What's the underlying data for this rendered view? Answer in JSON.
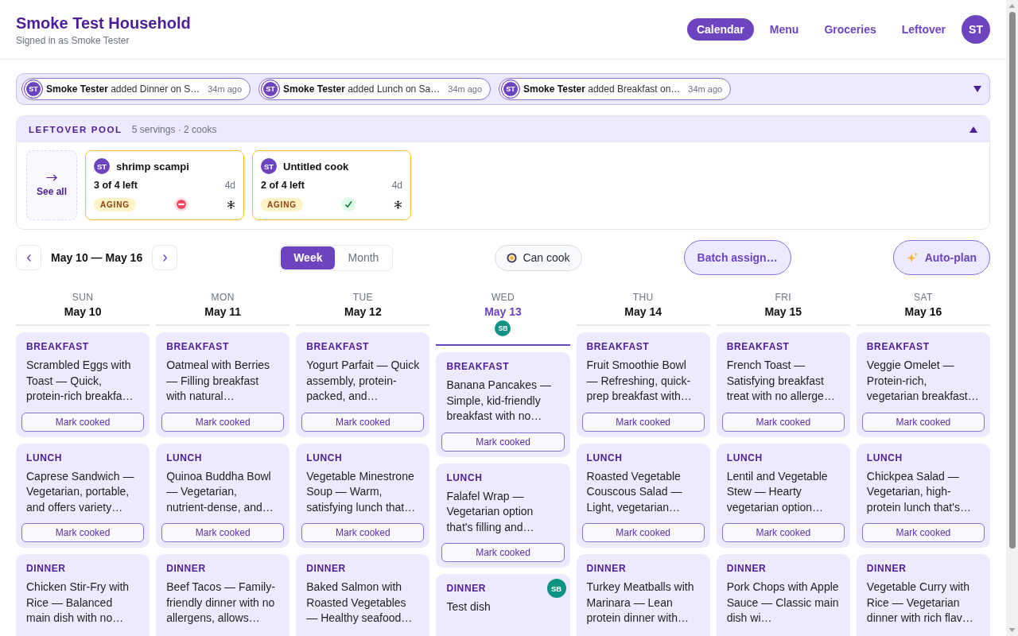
{
  "header": {
    "title": "Smoke Test Household",
    "subtitle": "Signed in as Smoke Tester",
    "nav": [
      {
        "label": "Calendar",
        "selected": true
      },
      {
        "label": "Menu",
        "selected": false
      },
      {
        "label": "Groceries",
        "selected": false
      },
      {
        "label": "Leftover",
        "selected": false
      }
    ],
    "avatar": "ST"
  },
  "activity": {
    "expanded": false,
    "items": [
      {
        "avatar": "ST",
        "text": "**Smoke Tester** added Dinner on S…",
        "time": "34m ago"
      },
      {
        "avatar": "ST",
        "text": "**Smoke Tester** added Lunch on Sa…",
        "time": "34m ago"
      },
      {
        "avatar": "ST",
        "text": "**Smoke Tester** added Breakfast on…",
        "time": "34m ago"
      }
    ]
  },
  "leftover_pool": {
    "title": "LEFTOVER POOL",
    "summary": "5 servings · 2 cooks",
    "expanded": true,
    "see_all": "See all",
    "items": [
      {
        "avatar": "ST",
        "name": "shrimp scampi",
        "remaining": "3 of 4 left",
        "age": "4d",
        "badge": "AGING",
        "blocked": true
      },
      {
        "avatar": "ST",
        "name": "Untitled cook",
        "remaining": "2 of 4 left",
        "age": "4d",
        "badge": "AGING",
        "blocked": false
      }
    ]
  },
  "toolbar": {
    "range": "May 10 — May 16",
    "views": [
      {
        "label": "Week",
        "selected": true
      },
      {
        "label": "Month",
        "selected": false
      }
    ],
    "can_cook": {
      "label": "Can cook",
      "on": false
    },
    "batch_button": "Batch assign…",
    "autoplan_button": "Auto-plan"
  },
  "days": [
    {
      "weekday": "SUN",
      "date": "May 10",
      "today": false,
      "meals": [
        {
          "label": "BREAKFAST",
          "dish": "Scrambled Eggs with Toast — Quick, protein-rich breakfa…",
          "button": "Mark cooked"
        },
        {
          "label": "LUNCH",
          "dish": "Caprese Sandwich — Vegetarian, portable, and offers variety…",
          "button": "Mark cooked"
        },
        {
          "label": "DINNER",
          "dish": "Chicken Stir-Fry with Rice — Balanced main dish with no…"
        }
      ]
    },
    {
      "weekday": "MON",
      "date": "May 11",
      "today": false,
      "meals": [
        {
          "label": "BREAKFAST",
          "dish": "Oatmeal with Berries — Filling breakfast with natural…",
          "button": "Mark cooked"
        },
        {
          "label": "LUNCH",
          "dish": "Quinoa Buddha Bowl — Vegetarian, nutrient-dense, and…",
          "button": "Mark cooked"
        },
        {
          "label": "DINNER",
          "dish": "Beef Tacos — Family-friendly dinner with no allergens, allows…"
        }
      ]
    },
    {
      "weekday": "TUE",
      "date": "May 12",
      "today": false,
      "meals": [
        {
          "label": "BREAKFAST",
          "dish": "Yogurt Parfait — Quick assembly, protein-packed, and…",
          "button": "Mark cooked"
        },
        {
          "label": "LUNCH",
          "dish": "Vegetable Minestrone Soup — Warm, satisfying lunch that…",
          "button": "Mark cooked"
        },
        {
          "label": "DINNER",
          "dish": "Baked Salmon with Roasted Vegetables — Healthy seafood…"
        }
      ]
    },
    {
      "weekday": "WED",
      "date": "May 13",
      "today": true,
      "badges": [
        {
          "text": "SB",
          "color": "#0f9483"
        }
      ],
      "meals": [
        {
          "label": "BREAKFAST",
          "dish": "Banana Pancakes — Simple, kid-friendly breakfast with no…",
          "button": "Mark cooked"
        },
        {
          "label": "LUNCH",
          "dish": "Falafel Wrap — Vegetarian option that's filling and…",
          "button": "Mark cooked"
        },
        {
          "label": "DINNER",
          "dish": "Test dish",
          "badge": {
            "text": "SB",
            "color": "#0f9483"
          }
        }
      ]
    },
    {
      "weekday": "THU",
      "date": "May 14",
      "today": false,
      "meals": [
        {
          "label": "BREAKFAST",
          "dish": "Fruit Smoothie Bowl — Refreshing, quick-prep breakfast with…",
          "button": "Mark cooked"
        },
        {
          "label": "LUNCH",
          "dish": "Roasted Vegetable Couscous Salad — Light, vegetarian…",
          "button": "Mark cooked"
        },
        {
          "label": "DINNER",
          "dish": "Turkey Meatballs with Marinara — Lean protein dinner with…"
        }
      ]
    },
    {
      "weekday": "FRI",
      "date": "May 15",
      "today": false,
      "meals": [
        {
          "label": "BREAKFAST",
          "dish": "French Toast — Satisfying breakfast treat with no allerge…",
          "button": "Mark cooked"
        },
        {
          "label": "LUNCH",
          "dish": "Lentil and Vegetable Stew — Hearty vegetarian option…",
          "button": "Mark cooked"
        },
        {
          "label": "DINNER",
          "dish": "Pork Chops with Apple Sauce — Classic main dish wi…"
        }
      ]
    },
    {
      "weekday": "SAT",
      "date": "May 16",
      "today": false,
      "meals": [
        {
          "label": "BREAKFAST",
          "dish": "Veggie Omelet — Protein-rich, vegetarian breakfast…",
          "button": "Mark cooked"
        },
        {
          "label": "LUNCH",
          "dish": "Chickpea Salad — Vegetarian, high-protein lunch that's…",
          "button": "Mark cooked"
        },
        {
          "label": "DINNER",
          "dish": "Vegetable Curry with Rice — Vegetarian dinner with rich flav…"
        }
      ]
    }
  ]
}
